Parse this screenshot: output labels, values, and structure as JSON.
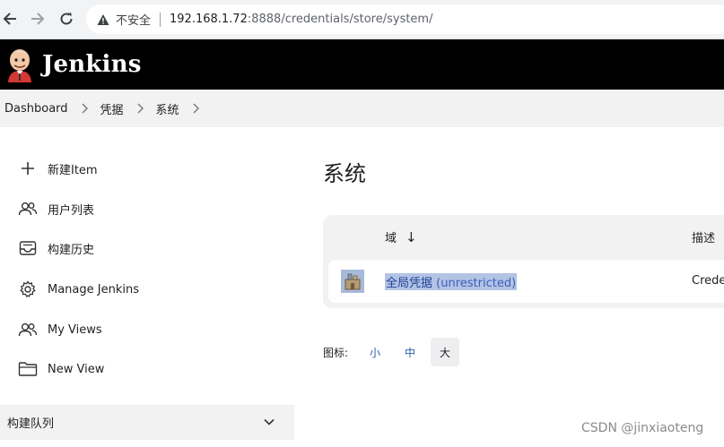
{
  "browser": {
    "security_label": "不安全",
    "url_host": "192.168.1.72",
    "url_rest": ":8888/credentials/store/system/"
  },
  "header": {
    "app_title": "Jenkins"
  },
  "breadcrumb": {
    "items": [
      "Dashboard",
      "凭据",
      "系统"
    ]
  },
  "sidebar": {
    "items": [
      {
        "label": "新建Item",
        "icon": "plus-icon"
      },
      {
        "label": "用户列表",
        "icon": "users-icon"
      },
      {
        "label": "构建历史",
        "icon": "inbox-icon"
      },
      {
        "label": "Manage Jenkins",
        "icon": "gear-icon"
      },
      {
        "label": "My Views",
        "icon": "users-icon"
      },
      {
        "label": "New View",
        "icon": "folder-icon"
      }
    ],
    "build_queue": "构建队列"
  },
  "main": {
    "title": "系统",
    "table": {
      "col_domain": "域",
      "sort_indicator": "↓",
      "col_description": "描述",
      "rows": [
        {
          "domain": "全局凭据",
          "domain_suffix": "(unrestricted)",
          "description": "Crede"
        }
      ]
    },
    "icon_size": {
      "label": "图标:",
      "options": [
        "小",
        "中",
        "大"
      ],
      "selected": "大"
    }
  },
  "watermark": "CSDN @jinxiaoteng",
  "colors": {
    "header_bg": "#000000",
    "link": "#21439c",
    "selection": "#b3c3e3"
  }
}
